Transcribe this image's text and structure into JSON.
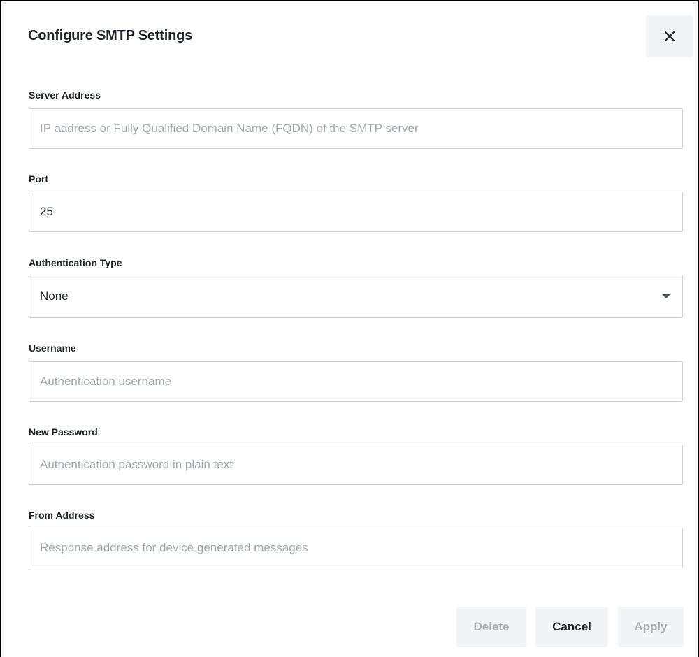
{
  "dialog": {
    "title": "Configure SMTP Settings",
    "close_icon": "close-icon"
  },
  "fields": {
    "server_address": {
      "label": "Server Address",
      "value": "",
      "placeholder": "IP address or Fully Qualified Domain Name (FQDN) of the SMTP server"
    },
    "port": {
      "label": "Port",
      "value": "25",
      "placeholder": ""
    },
    "authentication_type": {
      "label": "Authentication Type",
      "selected": "None",
      "caret_icon": "caret-down-icon"
    },
    "username": {
      "label": "Username",
      "value": "",
      "placeholder": "Authentication username"
    },
    "new_password": {
      "label": "New Password",
      "value": "",
      "placeholder": "Authentication password in plain text"
    },
    "from_address": {
      "label": "From Address",
      "value": "",
      "placeholder": "Response address for device generated messages"
    }
  },
  "actions": {
    "delete_label": "Delete",
    "cancel_label": "Cancel",
    "apply_label": "Apply"
  }
}
